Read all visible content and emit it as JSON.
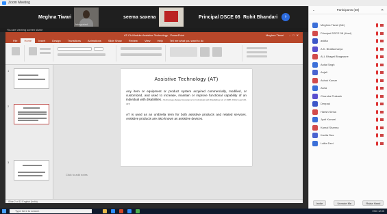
{
  "zoom": {
    "title": "Zoom Meeting",
    "tiles": [
      {
        "name": "Meghna Tiwari"
      },
      {
        "name": "",
        "camera_label": "Integrated"
      },
      {
        "name": "seema saxena"
      },
      {
        "name": "",
        "camera_label": "Camera"
      },
      {
        "name": "Principal DSCE 08"
      },
      {
        "name": "Rohit Bhandari"
      }
    ],
    "next_icon": "chevron-right-icon",
    "share_bar": "You are viewing screen share"
  },
  "powerpoint": {
    "title": "AT-Ch-Module-Assistive Technology - PowerPoint",
    "user": "Meghna Tiwari",
    "tabs": [
      "File",
      "Home",
      "Insert",
      "Design",
      "Transitions",
      "Animations",
      "Slide Show",
      "Review",
      "View",
      "Help",
      "Tell me what you want to do"
    ],
    "active_tab": "Home",
    "notes_placeholder": "Click to add notes",
    "status": "Slide 2 of 12    English (India)",
    "slide": {
      "title": "Assistive Technology (AT)",
      "paragraph1": "Any item or equipment or product system acquired commercially, modified, or customized, and used to increase, maintain or improve functional capability of an individual with disabilities.",
      "paragraph1_source": "(Technology-Related Assistance for Individuals with Disabilities Act of 1988, Public Law 100-407)",
      "paragraph2": "AT is used as an umbrella term for both assistive products and related services. Assistive products are also known as assistive devices."
    }
  },
  "participants_panel": {
    "title": "Participants (38)",
    "minimize_icon": "minimize-icon",
    "close_icon": "close-icon",
    "participants": [
      {
        "name": "Meghna Tiwari (Me)",
        "color": "#3b6fd8"
      },
      {
        "name": "Principal DSCE 08 (Host)",
        "color": "#d24b4b"
      },
      {
        "name": "ankita",
        "color": "#3d57c8"
      },
      {
        "name": "A.K. Bhattacharya",
        "color": "#5a4fcf"
      },
      {
        "name": "ALL Bhagat Bhagwane",
        "color": "#d24b4b"
      },
      {
        "name": "Anita Singh",
        "color": "#3b6fd8"
      },
      {
        "name": "Anjali",
        "color": "#4a63d0"
      },
      {
        "name": "Ashok Kumar",
        "color": "#d24b4b"
      },
      {
        "name": "Asha",
        "color": "#3b6fd8"
      },
      {
        "name": "Chandra Prakash",
        "color": "#5a4fcf"
      },
      {
        "name": "Deepak",
        "color": "#3d57c8"
      },
      {
        "name": "Harish Sinha",
        "color": "#d24b4b"
      },
      {
        "name": "Jyoti Kumari",
        "color": "#3b6fd8"
      },
      {
        "name": "Kamal Sharma",
        "color": "#d24b4b"
      },
      {
        "name": "Kavita Das",
        "color": "#4a63d0"
      },
      {
        "name": "Lalita Devi",
        "color": "#3b6fd8"
      }
    ],
    "buttons": [
      "Invite",
      "Unmute Me",
      "Raise Hand"
    ]
  },
  "taskbar": {
    "search_placeholder": "Type here to search",
    "tray": "ENG  12:05"
  }
}
